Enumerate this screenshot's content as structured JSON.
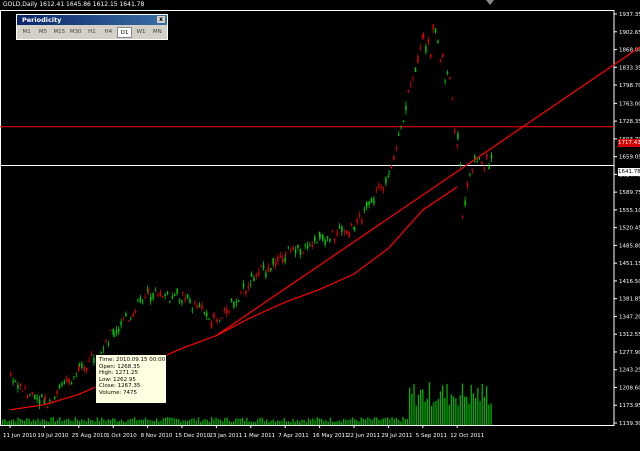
{
  "header": {
    "symbol_info": "GOLD,Daily  1612.41 1645.86 1612.15 1641.78"
  },
  "periodicity": {
    "title": "Periodicity",
    "close_label": "x",
    "buttons": [
      "M1",
      "M5",
      "M15",
      "M30",
      "H1",
      "H4",
      "D1",
      "W1",
      "MN"
    ],
    "active": "D1"
  },
  "tooltip": {
    "time": "Time: 2010.09.15 00:00",
    "open": "Open: 1268.35",
    "high": "High: 1271.25",
    "low": "Low: 1262.95",
    "close": "Close: 1267.35",
    "volume": "Volume: 7475"
  },
  "price_tags": {
    "red_line": "1717.43",
    "current": "1641.78"
  },
  "colors": {
    "bull": "#00c800",
    "bear": "#e00000",
    "ma": "#ff0000",
    "volume": "#00b000",
    "axis": "#ffffff",
    "hline_red": "#ff0000",
    "hline_white": "#ffffff"
  },
  "chart_data": {
    "type": "line",
    "title": "",
    "symbol": "GOLD",
    "timeframe": "Daily",
    "y_ticks": [
      "1937.35",
      "1902.65",
      "1868.00",
      "1833.35",
      "1798.70",
      "1763.00",
      "1728.35",
      "1693.70",
      "1659.05",
      "1624.40",
      "1589.75",
      "1555.10",
      "1520.45",
      "1485.80",
      "1451.15",
      "1416.50",
      "1381.85",
      "1347.20",
      "1312.55",
      "1277.90",
      "1243.25",
      "1208.60",
      "1173.95",
      "1139.30"
    ],
    "x_ticks": [
      "11 Jun 2010",
      "19 Jul 2010",
      "25 Aug 2010",
      "1 Oct 2010",
      "8 Nov 2010",
      "15 Dec 2010",
      "23 Jan 2011",
      "1 Mar 2011",
      "7 Apr 2011",
      "16 May 2011",
      "22 Jun 2011",
      "29 Jul 2011",
      "5 Sep 2011",
      "12 Oct 2011"
    ],
    "ylim": [
      1139.3,
      1937.35
    ],
    "price_path": [
      [
        "11 Jun 2010",
        1225
      ],
      [
        "19 Jul 2010",
        1180
      ],
      [
        "25 Aug 2010",
        1240
      ],
      [
        "1 Oct 2010",
        1315
      ],
      [
        "8 Nov 2010",
        1395
      ],
      [
        "15 Dec 2010",
        1385
      ],
      [
        "23 Jan 2011",
        1335
      ],
      [
        "1 Mar 2011",
        1420
      ],
      [
        "7 Apr 2011",
        1470
      ],
      [
        "16 May 2011",
        1500
      ],
      [
        "22 Jun 2011",
        1520
      ],
      [
        "29 Jul 2011",
        1625
      ],
      [
        "5 Sep 2011",
        1900
      ],
      [
        "12 Oct 2011",
        1670
      ]
    ],
    "moving_averages": [
      {
        "name": "",
        "color": "#ff0000",
        "values": [
          [
            "11 Jun 2010",
            1165
          ],
          [
            "19 Jul 2010",
            1175
          ],
          [
            "25 Aug 2010",
            1195
          ],
          [
            "1 Oct 2010",
            1225
          ],
          [
            "8 Nov 2010",
            1255
          ],
          [
            "15 Dec 2010",
            1285
          ],
          [
            "23 Jan 2011",
            1310
          ],
          [
            "1 Mar 2011",
            1345
          ],
          [
            "7 Apr 2011",
            1375
          ],
          [
            "16 May 2011",
            1400
          ],
          [
            "22 Jun 2011",
            1430
          ],
          [
            "29 Jul 2011",
            1480
          ],
          [
            "5 Sep 2011",
            1555
          ],
          [
            "12 Oct 2011",
            1600
          ]
        ]
      }
    ],
    "trendline": [
      [
        "23 Jan 2011",
        1310
      ],
      [
        "12 Oct 2011",
        1630
      ]
    ],
    "horizontal_lines": [
      1717.43,
      1641.78
    ],
    "volume_note": "volume histogram at bottom"
  }
}
